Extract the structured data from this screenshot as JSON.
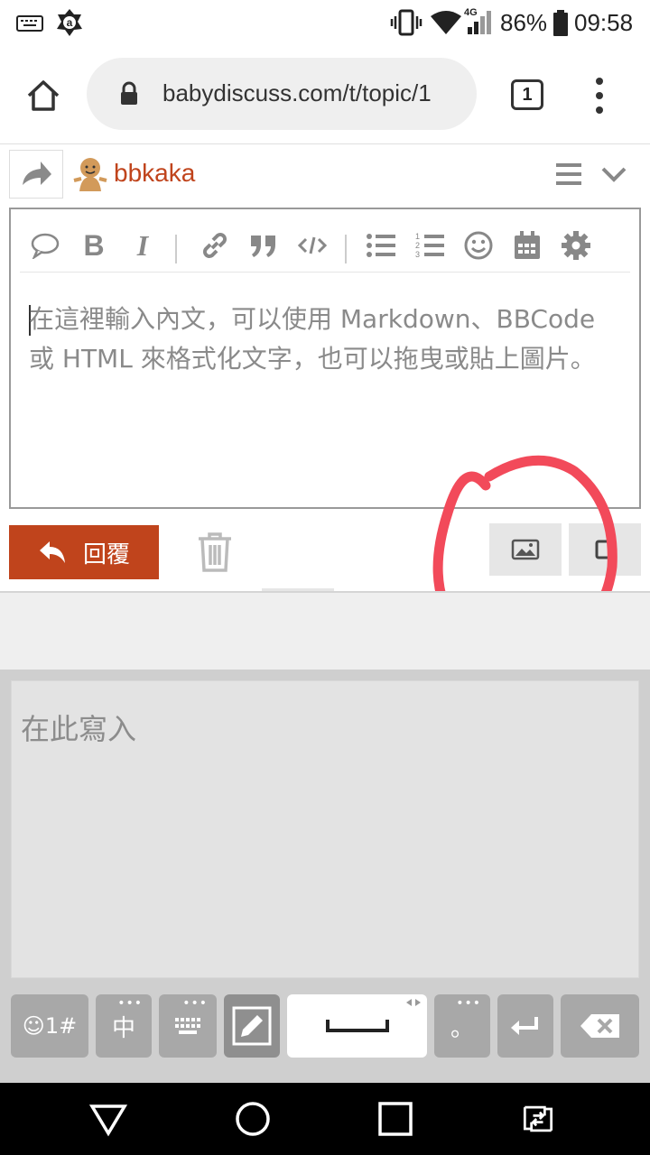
{
  "status_bar": {
    "network": "4G",
    "battery": "86%",
    "time": "09:58"
  },
  "browser": {
    "url": "babydiscuss.com/t/topic/1",
    "tab_count": "1"
  },
  "composer": {
    "username": "bbkaka",
    "editor_placeholder": "在這裡輸入內文，可以使用 Markdown、BBCode 或 HTML 來格式化文字，也可以拖曳或貼上圖片。",
    "toolbar_icons": [
      "quote-bubble-icon",
      "bold-icon",
      "italic-icon",
      "link-icon",
      "blockquote-icon",
      "code-icon",
      "bullet-list-icon",
      "numbered-list-icon",
      "emoji-icon",
      "calendar-icon",
      "gear-icon"
    ],
    "reply_label": "回覆"
  },
  "keyboard": {
    "write_placeholder": "在此寫入",
    "keys": {
      "symbols": "☺1#",
      "lang": "中",
      "period": "。"
    }
  },
  "colors": {
    "brand": "#c0441c",
    "annotation": "#f24a5a"
  }
}
